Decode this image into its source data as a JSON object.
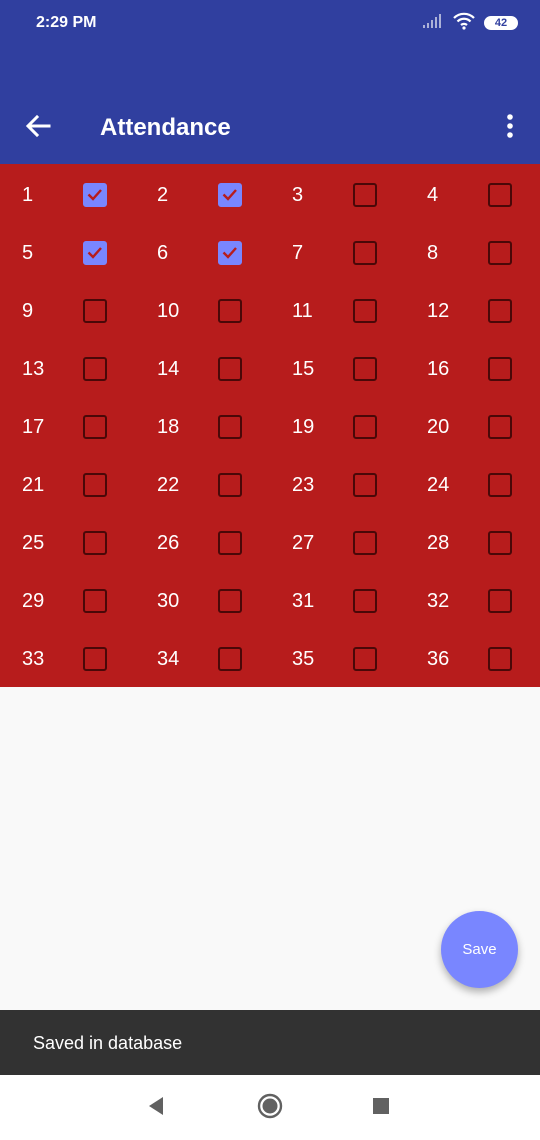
{
  "status_bar": {
    "time": "2:29 PM",
    "battery": "42",
    "icons": [
      "signal-icon",
      "wifi-icon",
      "battery-icon"
    ]
  },
  "app_bar": {
    "title": "Attendance",
    "back_icon": "arrow-back-icon",
    "menu_icon": "more-vert-icon"
  },
  "attendance": [
    {
      "number": "1",
      "checked": true
    },
    {
      "number": "2",
      "checked": true
    },
    {
      "number": "3",
      "checked": false
    },
    {
      "number": "4",
      "checked": false
    },
    {
      "number": "5",
      "checked": true
    },
    {
      "number": "6",
      "checked": true
    },
    {
      "number": "7",
      "checked": false
    },
    {
      "number": "8",
      "checked": false
    },
    {
      "number": "9",
      "checked": false
    },
    {
      "number": "10",
      "checked": false
    },
    {
      "number": "11",
      "checked": false
    },
    {
      "number": "12",
      "checked": false
    },
    {
      "number": "13",
      "checked": false
    },
    {
      "number": "14",
      "checked": false
    },
    {
      "number": "15",
      "checked": false
    },
    {
      "number": "16",
      "checked": false
    },
    {
      "number": "17",
      "checked": false
    },
    {
      "number": "18",
      "checked": false
    },
    {
      "number": "19",
      "checked": false
    },
    {
      "number": "20",
      "checked": false
    },
    {
      "number": "21",
      "checked": false
    },
    {
      "number": "22",
      "checked": false
    },
    {
      "number": "23",
      "checked": false
    },
    {
      "number": "24",
      "checked": false
    },
    {
      "number": "25",
      "checked": false
    },
    {
      "number": "26",
      "checked": false
    },
    {
      "number": "27",
      "checked": false
    },
    {
      "number": "28",
      "checked": false
    },
    {
      "number": "29",
      "checked": false
    },
    {
      "number": "30",
      "checked": false
    },
    {
      "number": "31",
      "checked": false
    },
    {
      "number": "32",
      "checked": false
    },
    {
      "number": "33",
      "checked": false
    },
    {
      "number": "34",
      "checked": false
    },
    {
      "number": "35",
      "checked": false
    },
    {
      "number": "36",
      "checked": false
    }
  ],
  "save_button": {
    "label": "Save"
  },
  "snackbar": {
    "message": "Saved in database"
  },
  "nav_bar": {
    "back_icon": "triangle-back-icon",
    "home_icon": "circle-home-icon",
    "recents_icon": "square-recents-icon"
  },
  "colors": {
    "primary": "#303f9f",
    "grid_background": "#b71c1c",
    "accent": "#7986ff",
    "snackbar": "#323232",
    "page_background": "#f9f9f9"
  }
}
